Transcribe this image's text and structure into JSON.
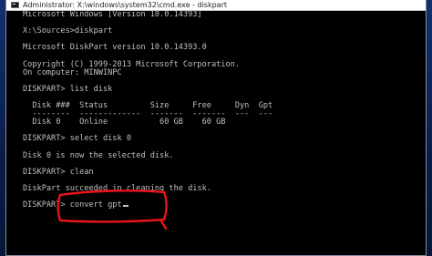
{
  "window": {
    "title": "Administrator: X:\\windows\\system32\\cmd.exe - diskpart"
  },
  "console": {
    "lines": [
      "Microsoft Windows [Version 10.0.14393]",
      "",
      "X:\\Sources>diskpart",
      "",
      "Microsoft DiskPart version 10.0.14393.0",
      "",
      "Copyright (C) 1999-2013 Microsoft Corporation.",
      "On computer: MINWINPC",
      "",
      "DISKPART> list disk",
      "",
      "  Disk ###  Status         Size     Free     Dyn  Gpt",
      "  --------  -------------  -------  -------  ---  ---",
      "  Disk 0    Online           60 GB    60 GB",
      "",
      "DISKPART> select disk 0",
      "",
      "Disk 0 is now the selected disk.",
      "",
      "DISKPART> clean",
      "",
      "DiskPart succeeded in cleaning the disk.",
      "",
      "DISKPART> convert gpt"
    ]
  },
  "colors": {
    "console_bg": "#000000",
    "console_text": "#c0c0c0",
    "annotation": "#e8141c",
    "desktop": "#0b1e4a"
  },
  "icons": {
    "window_icon": "cmd-icon",
    "annotation": "hand-drawn-highlight"
  }
}
